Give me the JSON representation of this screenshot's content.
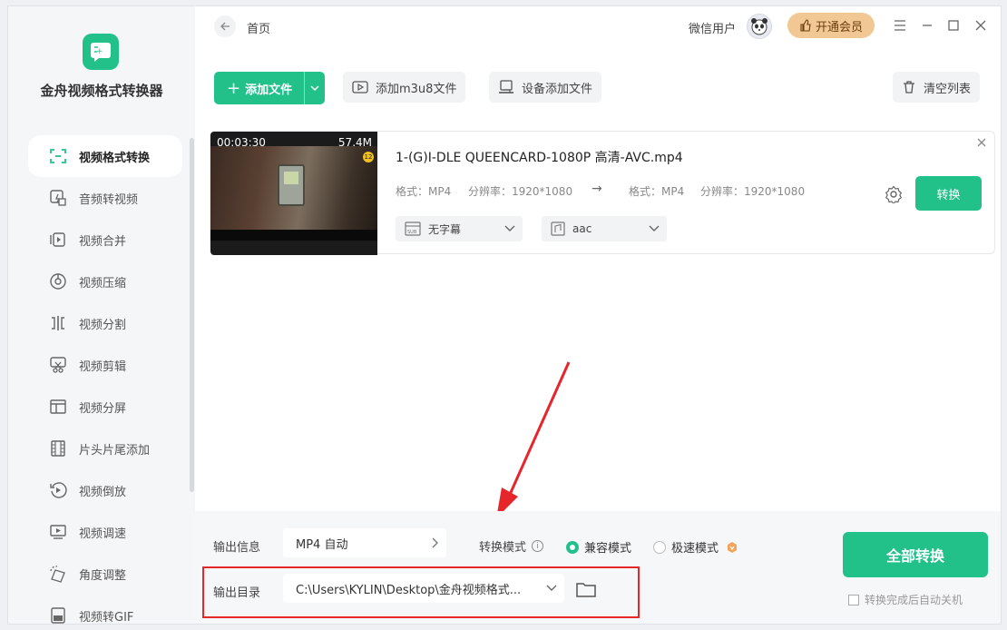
{
  "app": {
    "name": "金舟视频格式转换器",
    "accent": "#22c18a",
    "vip_color": "#f1c893",
    "highlight_color": "#e5262a"
  },
  "sidebar": {
    "items": [
      {
        "label": "视频格式转换",
        "icon": "convert-icon",
        "active": true
      },
      {
        "label": "音频转视频",
        "icon": "audio-to-video-icon"
      },
      {
        "label": "视频合并",
        "icon": "merge-icon"
      },
      {
        "label": "视频压缩",
        "icon": "compress-icon"
      },
      {
        "label": "视频分割",
        "icon": "split-icon"
      },
      {
        "label": "视频剪辑",
        "icon": "scissors-icon"
      },
      {
        "label": "视频分屏",
        "icon": "split-screen-icon"
      },
      {
        "label": "片头片尾添加",
        "icon": "film-strip-icon"
      },
      {
        "label": "视频倒放",
        "icon": "reverse-play-icon"
      },
      {
        "label": "视频调速",
        "icon": "speed-icon"
      },
      {
        "label": "角度调整",
        "icon": "rotate-icon"
      },
      {
        "label": "视频转GIF",
        "icon": "gif-icon"
      }
    ]
  },
  "header": {
    "breadcrumb": "首页",
    "user": "微信用户",
    "vip_label": "开通会员"
  },
  "toolbar": {
    "add_file": "添加文件",
    "add_m3u8": "添加m3u8文件",
    "add_device": "设备添加文件",
    "clear_list": "清空列表"
  },
  "file": {
    "duration": "00:03:30",
    "size": "57.4M",
    "name": "1-(G)I-DLE QUEENCARD-1080P 高清-AVC.mp4",
    "src_format": "格式：MP4",
    "src_resolution": "分辨率：1920*1080",
    "dst_format": "格式：MP4",
    "dst_resolution": "分辨率：1920*1080",
    "convert_label": "转换",
    "subtitle": "无字幕",
    "audio": "aac"
  },
  "bottom": {
    "output_info_label": "输出信息",
    "output_info_value": "MP4 自动",
    "mode_label": "转换模式",
    "mode_compatible": "兼容模式",
    "mode_fast": "极速模式",
    "output_dir_label": "输出目录",
    "output_dir_value": "C:\\Users\\KYLIN\\Desktop\\金舟视频格式...",
    "convert_all": "全部转换",
    "auto_shutdown": "转换完成后自动关机"
  }
}
